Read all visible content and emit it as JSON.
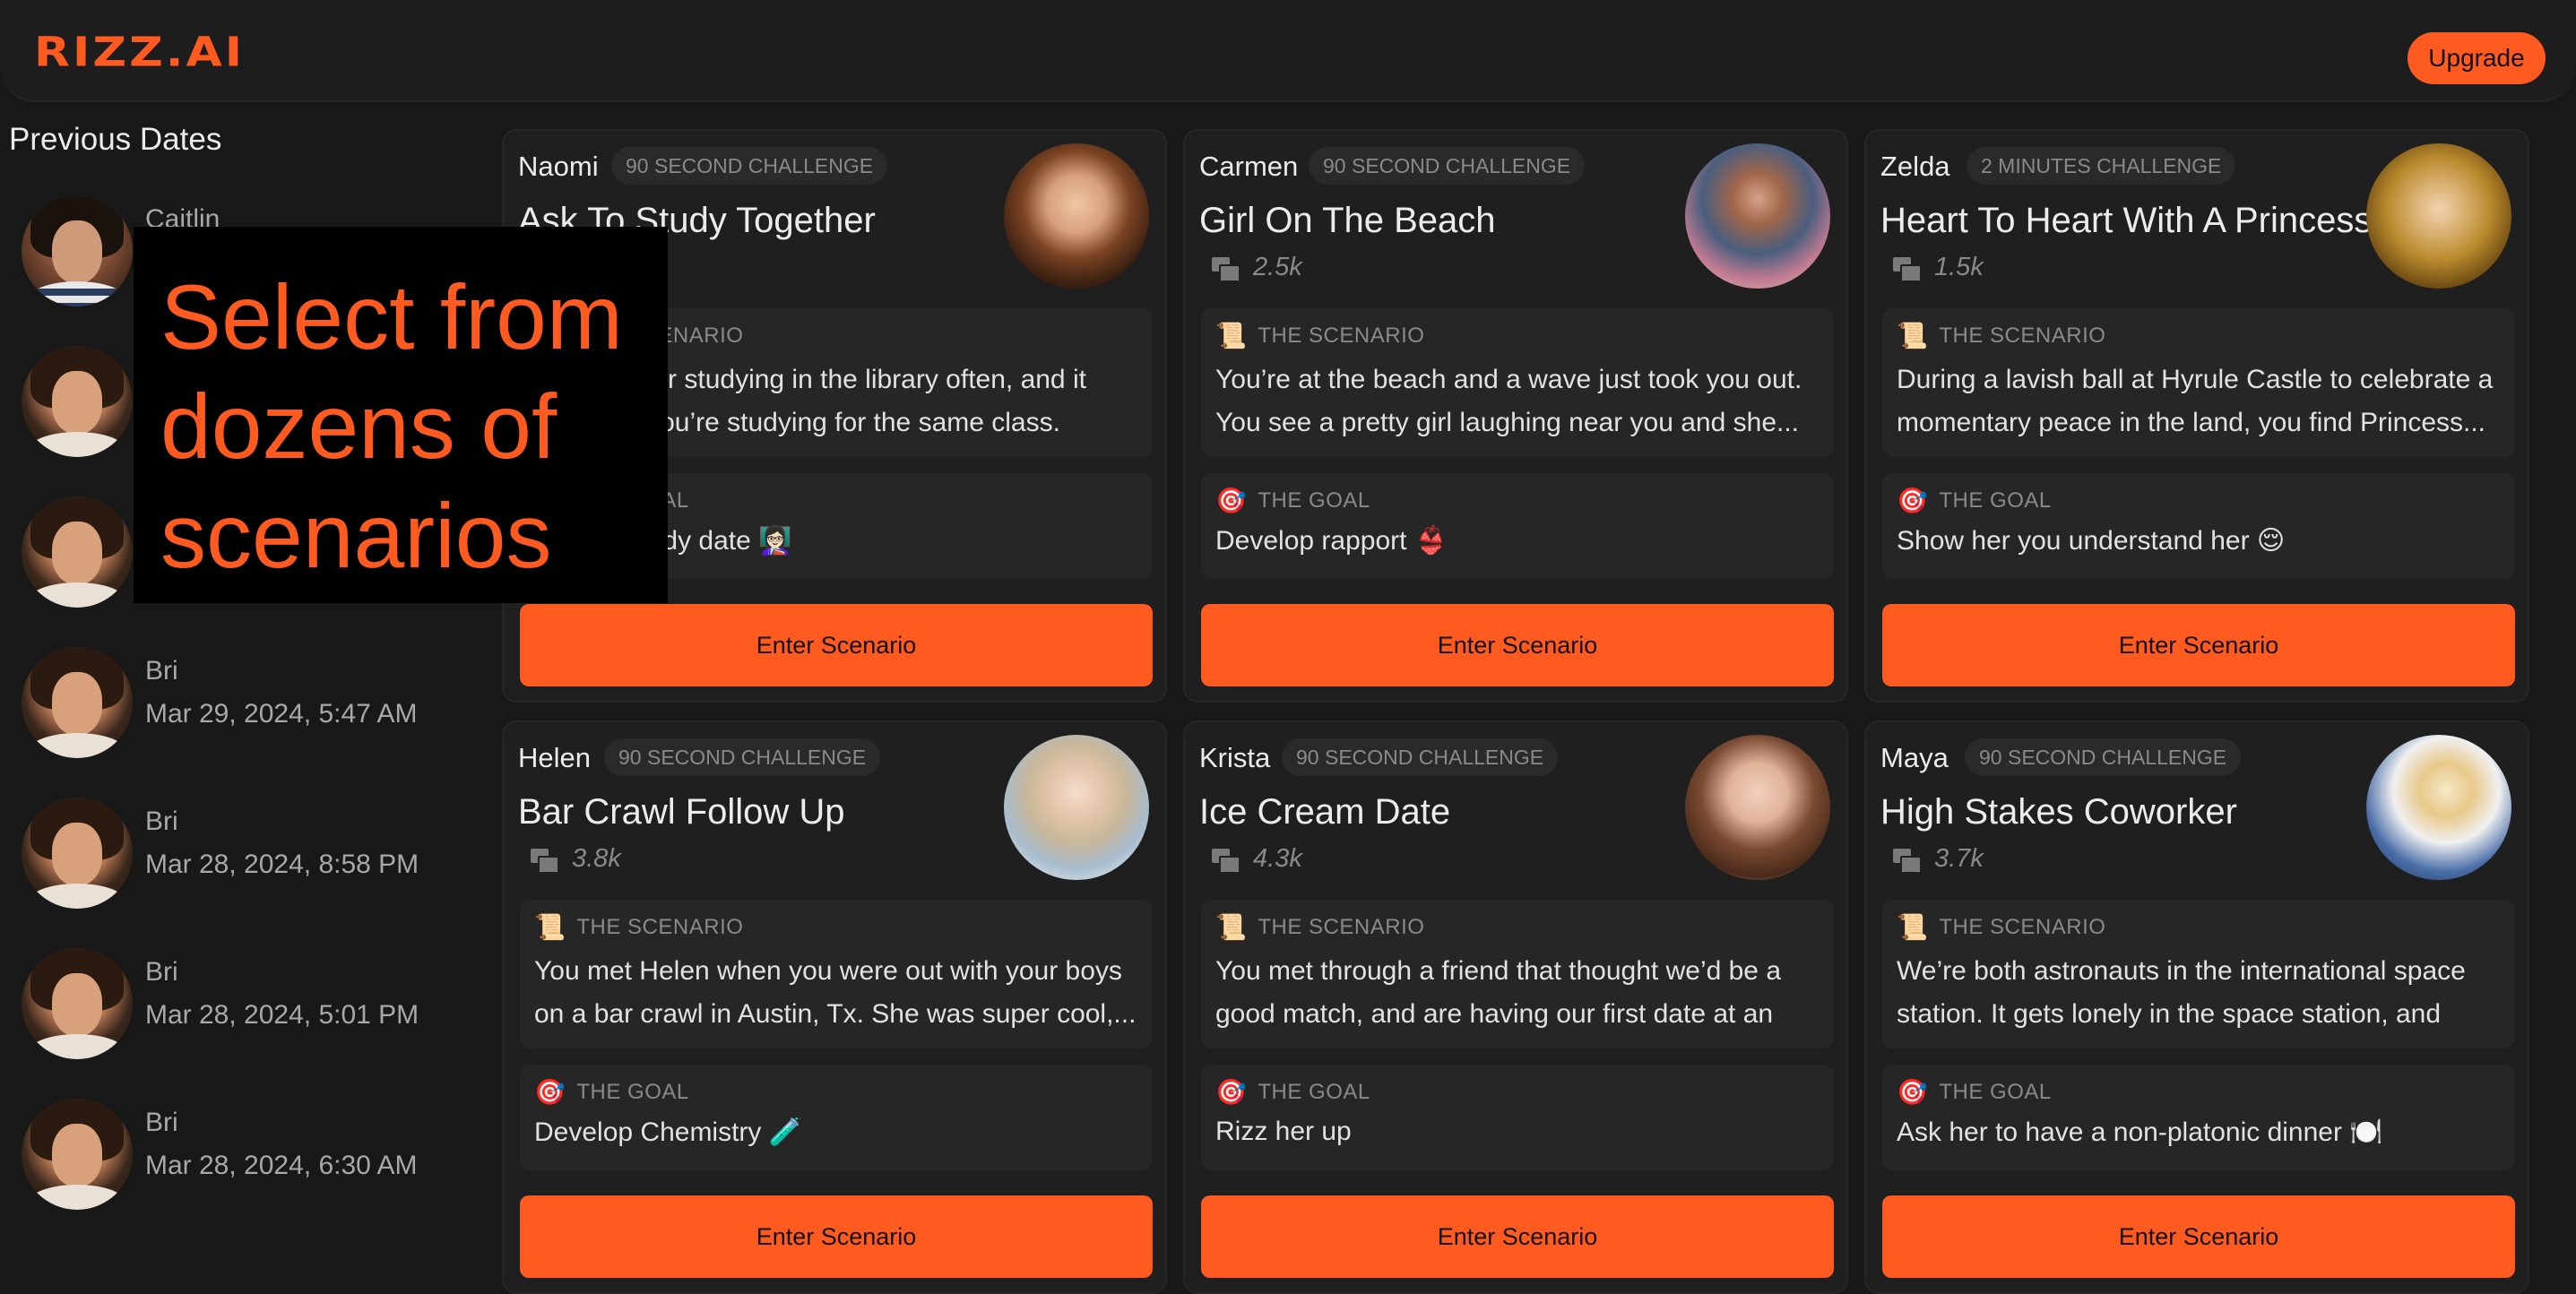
{
  "header": {
    "logo": "RIZZ.AI",
    "upgrade_label": "Upgrade"
  },
  "sidebar": {
    "title": "Previous Dates",
    "items": [
      {
        "name": "Caitlin",
        "time": ""
      },
      {
        "name": "",
        "time": ""
      },
      {
        "name": "",
        "time": ""
      },
      {
        "name": "Bri",
        "time": "Mar 29, 2024, 5:47 AM"
      },
      {
        "name": "Bri",
        "time": "Mar 28, 2024, 8:58 PM"
      },
      {
        "name": "Bri",
        "time": "Mar 28, 2024, 5:01 PM"
      },
      {
        "name": "Bri",
        "time": "Mar 28, 2024, 6:30 AM"
      }
    ]
  },
  "overlay": {
    "text": "Select from dozens of scenarios"
  },
  "labels": {
    "scenario_heading": "THE SCENARIO",
    "goal_heading": "THE GOAL",
    "enter_label": "Enter Scenario"
  },
  "cards": [
    {
      "name": "Naomi",
      "challenge": "90 SECOND CHALLENGE",
      "title": "Ask To Study Together",
      "plays": "",
      "scenario": "You see her studying in the library often, and it turns out you’re studying for the same class. Offe...",
      "goal": "Have a study date 👩🏻‍🏫"
    },
    {
      "name": "Carmen",
      "challenge": "90 SECOND CHALLENGE",
      "title": "Girl On The Beach",
      "plays": "2.5k",
      "scenario": "You’re at the beach and a wave just took you out. You see a pretty girl laughing near you and she...",
      "goal": "Develop rapport 👙"
    },
    {
      "name": "Zelda",
      "challenge": "2 MINUTES CHALLENGE",
      "title": "Heart To Heart With A Princess",
      "plays": "1.5k",
      "scenario": "During a lavish ball at Hyrule Castle to celebrate a momentary peace in the land, you find Princess...",
      "goal": "Show her you understand her 😌"
    },
    {
      "name": "Helen",
      "challenge": "90 SECOND CHALLENGE",
      "title": "Bar Crawl Follow Up",
      "plays": "3.8k",
      "scenario": "You met Helen when you were out with your boys on a bar crawl in Austin, Tx. She was super cool,...",
      "goal": "Develop Chemistry 🧪"
    },
    {
      "name": "Krista",
      "challenge": "90 SECOND CHALLENGE",
      "title": "Ice Cream Date",
      "plays": "4.3k",
      "scenario": "You met through a friend that thought we’d be a good match, and are having our first date at an ic...",
      "goal": "Rizz her up"
    },
    {
      "name": "Maya",
      "challenge": "90 SECOND CHALLENGE",
      "title": "High Stakes Coworker",
      "plays": "3.7k",
      "scenario": "We’re both astronauts in the international space station. It gets lonely in the space station, and whi...",
      "goal": "Ask her to have a non-platonic dinner 🍽️"
    }
  ],
  "colors": {
    "accent": "#ff5a1f",
    "background": "#181818",
    "card": "#1f1f1f",
    "section": "#262626"
  }
}
